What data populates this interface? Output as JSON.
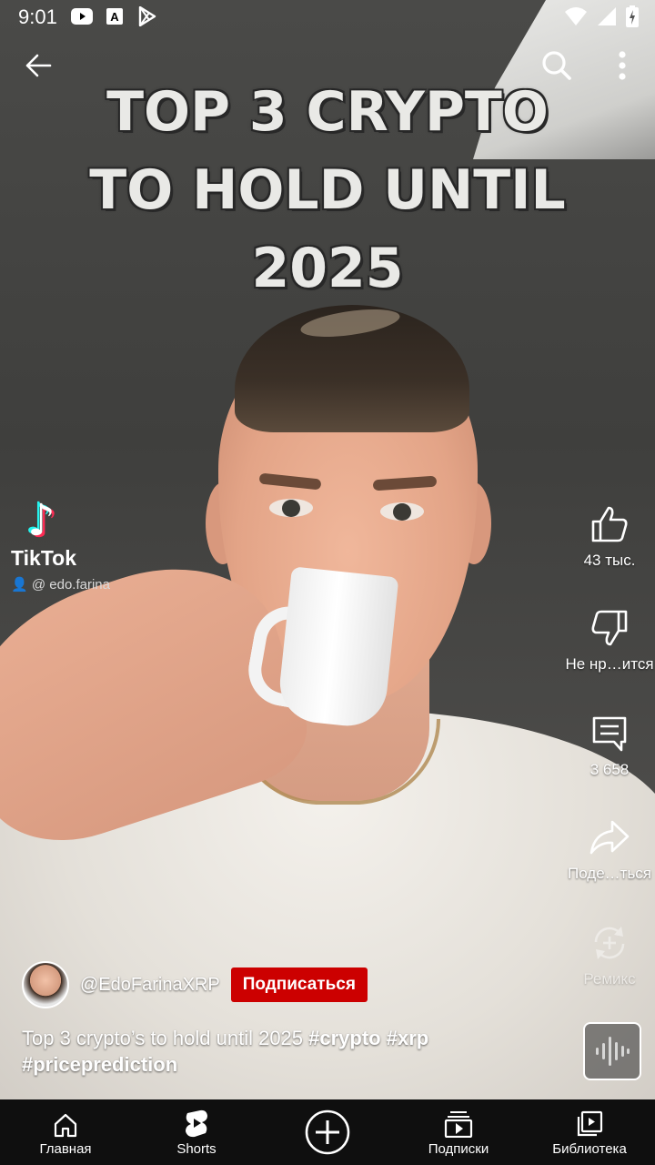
{
  "status_bar": {
    "time": "9:01",
    "icons": [
      "youtube-icon",
      "font-a-icon",
      "play-store-icon"
    ],
    "right_icons": [
      "wifi-icon",
      "signal-icon",
      "battery-icon"
    ]
  },
  "video": {
    "overlay_title_lines": [
      "TOP 3 CRYPTO",
      "TO HOLD UNTIL",
      "2025"
    ],
    "tiktok_brand": "TikTok",
    "tiktok_user": "@ edo.farina"
  },
  "actions": {
    "like_count": "43 тыс.",
    "dislike_label": "Не нр…ится",
    "comments_count": "3 658",
    "share_label": "Поде…ться",
    "remix_label": "Ремикс"
  },
  "channel": {
    "name": "@EdoFarinaXRP",
    "subscribe_label": "Подписаться"
  },
  "caption": {
    "text": "Top 3 crypto’s to hold until 2025 ",
    "hashtags": [
      "#crypto",
      "#xrp",
      "#priceprediction"
    ]
  },
  "nav": {
    "home": "Главная",
    "shorts": "Shorts",
    "subscriptions": "Подписки",
    "library": "Библиотека"
  },
  "colors": {
    "subscribe_bg": "#cc0000",
    "nav_bg": "#0f0f0f"
  }
}
